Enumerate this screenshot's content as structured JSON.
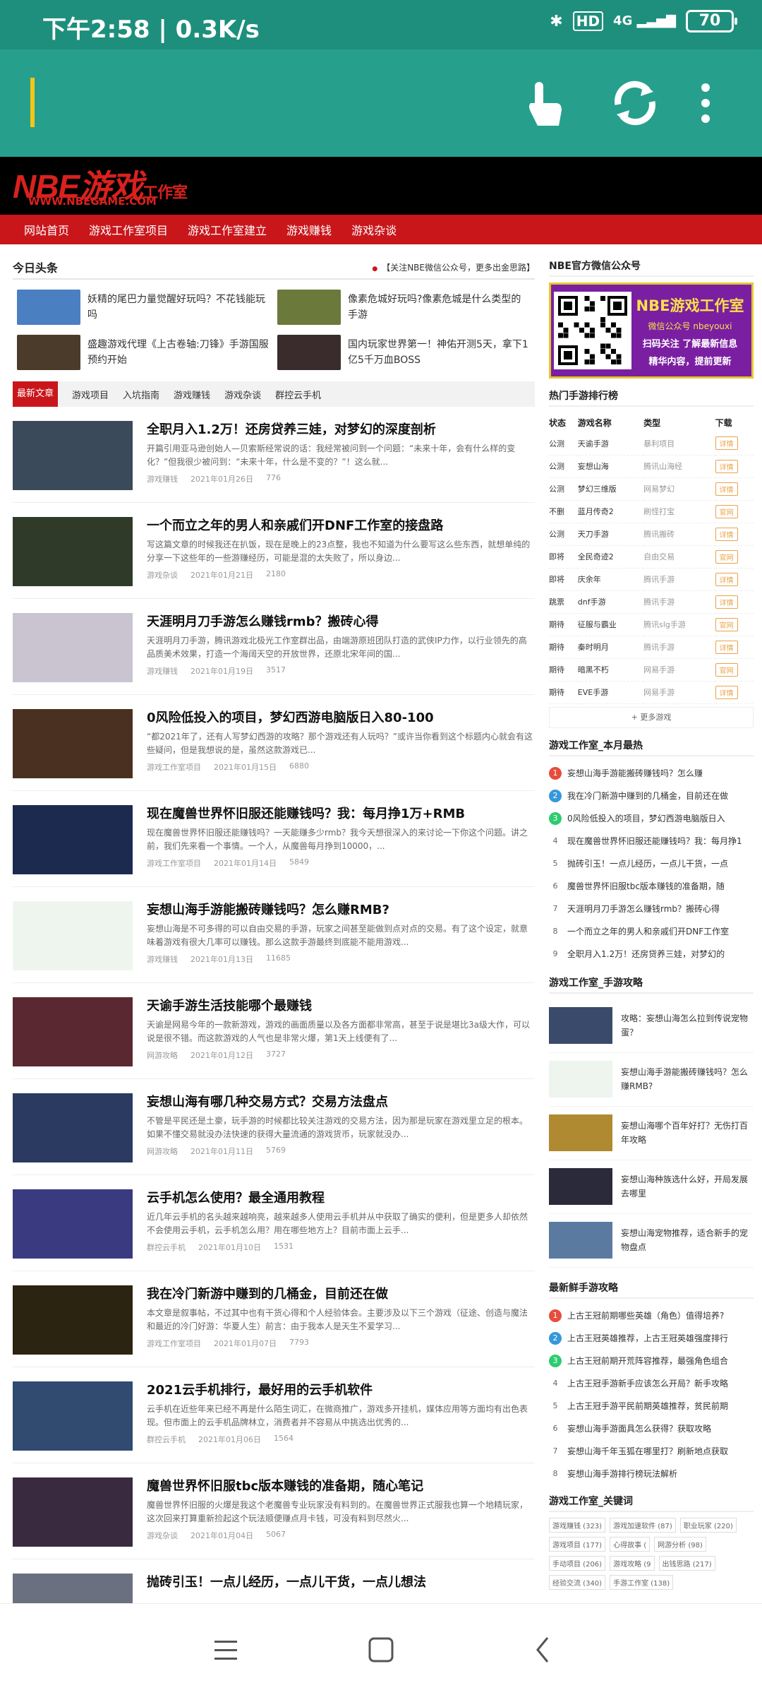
{
  "status": {
    "time": "下午2:58 | 0.3K/s",
    "hd": "HD",
    "network": "4G",
    "battery": "70"
  },
  "site": {
    "logo": "NBE游戏",
    "logo_sub": "工作室",
    "logo_url": "WWW.NBEGAME.COM",
    "nav": [
      "网站首页",
      "游戏工作室项目",
      "游戏工作室建立",
      "游戏赚钱",
      "游戏杂谈"
    ]
  },
  "headlines": {
    "title": "今日头条",
    "notice": "【关注NBE微信公众号，更多出金思路】",
    "items": [
      {
        "text": "妖精的尾巴力量觉醒好玩吗？不花钱能玩吗",
        "color": "#4a7fc1"
      },
      {
        "text": "像素危城好玩吗?像素危城是什么类型的手游",
        "color": "#6b7a3a"
      },
      {
        "text": "盛趣游戏代理《上古卷轴:刀锋》手游国服预约开始",
        "color": "#4b3b2a"
      },
      {
        "text": "国内玩家世界第一！神佑开测5天，拿下1亿5千万血BOSS",
        "color": "#3a2c2c"
      }
    ]
  },
  "tabs": [
    "最新文章",
    "游戏项目",
    "入坑指南",
    "游戏赚钱",
    "游戏杂谈",
    "群控云手机"
  ],
  "articles": [
    {
      "title": "全职月入1.2万！还房贷养三娃，对梦幻的深度剖析",
      "excerpt": "开篇引用亚马逊创始人—贝索斯经常说的话：我经常被问到一个问题：“未来十年，会有什么样的变化？”但我很少被问到：“未来十年，什么是不变的？”！这么就...",
      "cat": "游戏赚钱",
      "date": "2021年01月26日",
      "views": "776",
      "color": "#3b4a5a"
    },
    {
      "title": "一个而立之年的男人和亲戚们开DNF工作室的接盘路",
      "excerpt": "写这篇文章的时候我还在扒饭，现在是晚上的23点整，我也不知道为什么要写这么些东西，就想单纯的分享一下这些年的一些游赚经历，可能是混的太失败了，所以身边...",
      "cat": "游戏杂谈",
      "date": "2021年01月21日",
      "views": "2180",
      "color": "#2f3a28"
    },
    {
      "title": "天涯明月刀手游怎么赚钱rmb？搬砖心得",
      "excerpt": "天涯明月刀手游，腾讯游戏北极光工作室群出品，由端游原班团队打造的武侠IP力作，以行业领先的高品质美术效果，打造一个海阔天空的开放世界，还原北宋年间的国...",
      "cat": "游戏赚钱",
      "date": "2021年01月19日",
      "views": "3517",
      "color": "#c9c4d0"
    },
    {
      "title": "0风险低投入的项目，梦幻西游电脑版日入80-100",
      "excerpt": "“都2021年了，还有人写梦幻西游的攻略？那个游戏还有人玩吗？”或许当你看到这个标题内心就会有这些疑问，但是我想说的是，虽然这款游戏已...",
      "cat": "游戏工作室项目",
      "date": "2021年01月15日",
      "views": "6880",
      "color": "#4a3020"
    },
    {
      "title": "现在魔兽世界怀旧服还能赚钱吗？我：每月挣1万+RMB",
      "excerpt": "现在魔兽世界怀旧服还能赚钱吗？一天能赚多少rmb？我今天想很深入的来讨论一下你这个问题。讲之前，我们先来看一个事情。一个人，从魔兽每月挣到10000，...",
      "cat": "游戏工作室项目",
      "date": "2021年01月14日",
      "views": "5849",
      "color": "#1c2a50"
    },
    {
      "title": "妄想山海手游能搬砖赚钱吗？怎么赚RMB?",
      "excerpt": "妄想山海是不可多得的可以自由交易的手游，玩家之间甚至能做到点对点的交易。有了这个设定，就意味着游戏有很大几率可以赚钱。那么这款手游最终到底能不能用游戏...",
      "cat": "游戏赚钱",
      "date": "2021年01月13日",
      "views": "11685",
      "color": "#eef5ee"
    },
    {
      "title": "天谕手游生活技能哪个最赚钱",
      "excerpt": "天谕是网易今年的一款新游戏，游戏的画面质量以及各方面都非常高，甚至于说是堪比3a级大作，可以说是很不错。而这款游戏的人气也是非常火爆，第1天上线便有了...",
      "cat": "网游攻略",
      "date": "2021年01月12日",
      "views": "3727",
      "color": "#5a2830"
    },
    {
      "title": "妄想山海有哪几种交易方式？交易方法盘点",
      "excerpt": "不管是平民还是土豪，玩手游的时候都比较关注游戏的交易方法，因为那是玩家在游戏里立足的根本。如果不懂交易就没办法快速的获得大量流通的游戏货币，玩家就没办...",
      "cat": "网游攻略",
      "date": "2021年01月11日",
      "views": "5769",
      "color": "#2a3a60"
    },
    {
      "title": "云手机怎么使用？最全通用教程",
      "excerpt": "近几年云手机的名头越来越响亮，越来越多人使用云手机并从中获取了确实的便利，但是更多人却依然不会使用云手机，云手机怎么用？用在哪些地方上？目前市面上云手...",
      "cat": "群控云手机",
      "date": "2021年01月10日",
      "views": "1531",
      "color": "#3a3a80"
    },
    {
      "title": "我在冷门新游中赚到的几桶金，目前还在做",
      "excerpt": "本文章是叙事帖，不过其中也有干货心得和个人经验体会。主要涉及以下三个游戏（征途、创造与魔法 和最近的冷门好游：华夏人生）前言：由于我本人是天生不爱学习...",
      "cat": "游戏工作室项目",
      "date": "2021年01月07日",
      "views": "7793",
      "color": "#2a2410"
    },
    {
      "title": "2021云手机排行，最好用的云手机软件",
      "excerpt": "云手机在近些年来已经不再是什么陌生词汇，在微商推广，游戏多开挂机，媒体应用等方面均有出色表现。但市面上的云手机品牌林立，消费者并不容易从中挑选出优秀的...",
      "cat": "群控云手机",
      "date": "2021年01月06日",
      "views": "1564",
      "color": "#304a70"
    },
    {
      "title": "魔兽世界怀旧服tbc版本赚钱的准备期，随心笔记",
      "excerpt": "魔兽世界怀旧服的火爆是我这个老魔兽专业玩家没有料到的。在魔兽世界正式服我也算一个地精玩家，这次回来打算重新捡起这个玩法顺便赚点月卡钱，可没有料到尽然火...",
      "cat": "游戏杂谈",
      "date": "2021年01月04日",
      "views": "5067",
      "color": "#3a2a40"
    },
    {
      "title": "抛砖引玉！一点儿经历，一点儿干货，一点儿想法",
      "excerpt": "",
      "cat": "",
      "date": "",
      "views": "",
      "color": "#6a7080"
    }
  ],
  "wechat": {
    "title": "NBE官方微信公众号",
    "line1": "NBE游戏工作室",
    "line2": "微信公众号 nbeyouxi",
    "line3": "扫码关注 了解最新信息",
    "line4": "精华内容，提前更新"
  },
  "ranking": {
    "title": "热门手游排行榜",
    "headers": [
      "状态",
      "游戏名称",
      "类型",
      "下载"
    ],
    "rows": [
      [
        "公测",
        "天谕手游",
        "暴利项目",
        "详情"
      ],
      [
        "公测",
        "妄想山海",
        "腾讯山海经",
        "详情"
      ],
      [
        "公测",
        "梦幻三维版",
        "网易梦幻",
        "详情"
      ],
      [
        "不删",
        "蓝月传奇2",
        "刷怪打宝",
        "官网"
      ],
      [
        "公测",
        "天刀手游",
        "腾讯搬砖",
        "详情"
      ],
      [
        "即将",
        "全民奇迹2",
        "自由交易",
        "官网"
      ],
      [
        "即将",
        "庆余年",
        "腾讯手游",
        "详情"
      ],
      [
        "跳票",
        "dnf手游",
        "腾讯手游",
        "详情"
      ],
      [
        "期待",
        "征服与霸业",
        "腾讯slg手游",
        "官网"
      ],
      [
        "期待",
        "秦时明月",
        "腾讯手游",
        "详情"
      ],
      [
        "期待",
        "暗黑不朽",
        "网易手游",
        "官网"
      ],
      [
        "期待",
        "EVE手游",
        "网易手游",
        "详情"
      ]
    ],
    "more": "+ 更多游戏"
  },
  "monthly": {
    "title": "游戏工作室_本月最热",
    "items": [
      "妄想山海手游能搬砖赚钱吗？怎么赚",
      "我在冷门新游中赚到的几桶金，目前还在做",
      "0风险低投入的项目，梦幻西游电脑版日入",
      "现在魔兽世界怀旧服还能赚钱吗？我：每月挣1",
      "抛砖引玉！一点儿经历，一点儿干货，一点",
      "魔兽世界怀旧服tbc版本赚钱的准备期，随",
      "天涯明月刀手游怎么赚钱rmb？搬砖心得",
      "一个而立之年的男人和亲戚们开DNF工作室",
      "全职月入1.2万！还房贷养三娃，对梦幻的"
    ]
  },
  "guides": {
    "title": "游戏工作室_手游攻略",
    "items": [
      {
        "text": "攻略：妄想山海怎么拉到传说宠物蛋？",
        "color": "#3a4a6a"
      },
      {
        "text": "妄想山海手游能搬砖赚钱吗？怎么赚RMB?",
        "color": "#eef5ee"
      },
      {
        "text": "妄想山海哪个百年好打？无伤打百年攻略",
        "color": "#b08a30"
      },
      {
        "text": "妄想山海种族选什么好，开局发展去哪里",
        "color": "#2a2a3a"
      },
      {
        "text": "妄想山海宠物推荐，适合新手的宠物盘点",
        "color": "#5a7aa0"
      }
    ]
  },
  "newbie": {
    "title": "最新鲜手游攻略",
    "items": [
      "上古王冠前期哪些英雄（角色）值得培养?",
      "上古王冠英雄推荐，上古王冠英雄强度排行",
      "上古王冠前期开荒阵容推荐，最强角色组合",
      "上古王冠手游新手应该怎么开局？新手攻略",
      "上古王冠手游平民前期英雄推荐，贫民前期",
      "妄想山海手游面具怎么获得？获取攻略",
      "妄想山海千年玉狐在哪里打？刷新地点获取",
      "妄想山海手游排行榜玩法解析"
    ]
  },
  "keywords": {
    "title": "游戏工作室_关键词",
    "items": [
      "游戏赚钱 (323)",
      "游戏加速软件 (87)",
      "职业玩家 (220)",
      "游戏项目 (177)",
      "心得故事 (",
      "网游分析 (98)",
      "手动项目 (206)",
      "游戏攻略 (9",
      "出钱思路 (217)",
      "经验交流 (340)",
      "手游工作室 (138)"
    ]
  }
}
